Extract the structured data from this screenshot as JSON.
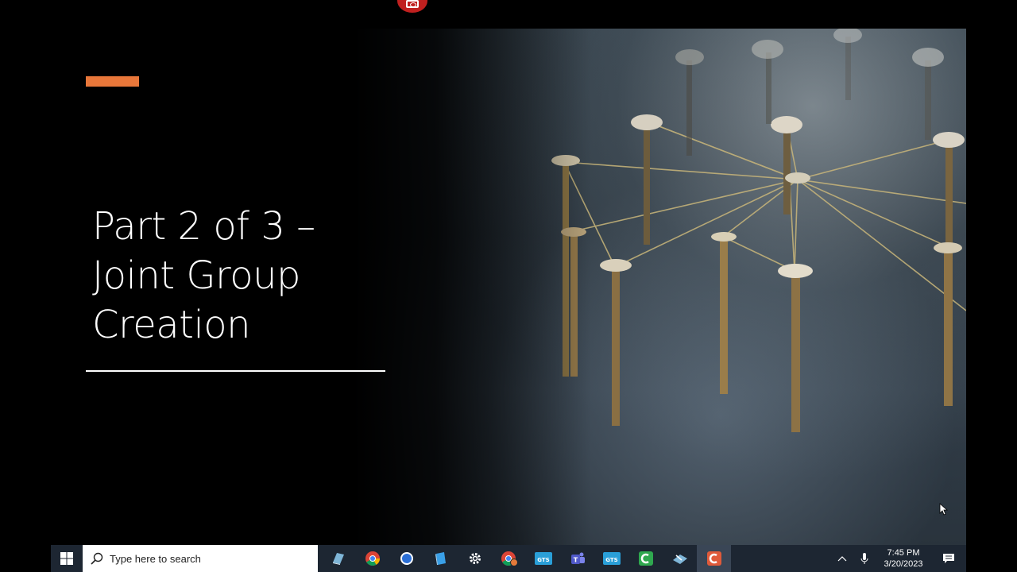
{
  "slide": {
    "title_lines": [
      "Part 2 of 3 –",
      "Joint Group",
      "Creation"
    ],
    "accent_color": "#e8773a",
    "background_image": "nails-and-string-network-photo"
  },
  "recording": {
    "icon": "camera-icon",
    "color": "#c0201f"
  },
  "taskbar": {
    "start_icon": "windows-logo-icon",
    "search_placeholder": "Type here to search",
    "apps": [
      {
        "name": "app-icon-blue-book"
      },
      {
        "name": "chrome-icon"
      },
      {
        "name": "chat-bubble-icon"
      },
      {
        "name": "blue-cube-icon"
      },
      {
        "name": "settings-gear-icon"
      },
      {
        "name": "chrome-profile-icon"
      },
      {
        "name": "gts-app-icon",
        "label": "GTS"
      },
      {
        "name": "teams-icon"
      },
      {
        "name": "gts-app-icon-2",
        "label": "GTS"
      },
      {
        "name": "camtasia-green-icon"
      },
      {
        "name": "pen-tablet-icon"
      },
      {
        "name": "camtasia-recorder-icon"
      }
    ],
    "clock": {
      "time": "7:45 PM",
      "date": "3/20/2023"
    }
  }
}
